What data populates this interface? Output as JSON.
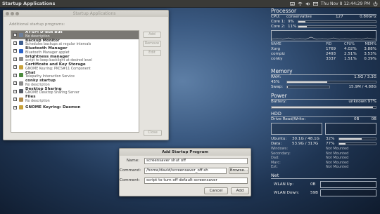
{
  "panel": {
    "title": "Startup Applications",
    "clock": "Thu Nov 8 12:44:29 PM",
    "icons": [
      "keyboard-icon",
      "wifi-icon",
      "volume-icon",
      "mail-icon",
      "power-icon"
    ]
  },
  "startup_window": {
    "section_label": "Additional startup programs:",
    "add_label": "Add",
    "remove_label": "Remove",
    "edit_label": "Edit",
    "close_label": "Close",
    "programs": [
      {
        "name": "AT-SPI D-Bus Bus",
        "description": "No description",
        "checked": true,
        "selected": true,
        "icon": "#6d7f9a"
      },
      {
        "name": "Backup Monitor",
        "description": "Schedules backups at regular intervals",
        "checked": true,
        "selected": false,
        "icon": "#3e5e8e"
      },
      {
        "name": "Bluetooth Manager",
        "description": "Bluetooth Manager applet",
        "checked": true,
        "selected": false,
        "icon": "#2a62c8"
      },
      {
        "name": "brightness manager",
        "description": "script to keep backlight at desired level",
        "checked": true,
        "selected": false,
        "icon": "#8a8a8a"
      },
      {
        "name": "Certificate and Key Storage",
        "description": "GNOME Keyring: PKCS#11 Component",
        "checked": true,
        "selected": false,
        "icon": "#c8a13a"
      },
      {
        "name": "Chat",
        "description": "Telepathy Interaction Service",
        "checked": true,
        "selected": false,
        "icon": "#4b8a3c"
      },
      {
        "name": "conky startup",
        "description": "No description",
        "checked": true,
        "selected": false,
        "icon": "#8a8a8a"
      },
      {
        "name": "Desktop Sharing",
        "description": "GNOME Desktop Sharing Server",
        "checked": true,
        "selected": false,
        "icon": "#555b66"
      },
      {
        "name": "Files",
        "description": "No description",
        "checked": true,
        "selected": false,
        "icon": "#b08a4a"
      },
      {
        "name": "GNOME Keyring: Daemon",
        "description": "",
        "checked": true,
        "selected": false,
        "icon": "#c8a13a"
      }
    ]
  },
  "add_dialog": {
    "title": "Add Startup Program",
    "name_label": "Name:",
    "name_value": "screensaver shut off",
    "command_label": "Command:",
    "command_value": "/home/david/screensaver_off.sh",
    "comment_label": "Comment:",
    "comment_value": "script to turn off default screensaver",
    "browse_label": "Browse...",
    "cancel_label": "Cancel",
    "add_label": "Add"
  },
  "conky": {
    "processor": {
      "title": "Processor",
      "cpu_label": "CPU:",
      "governor": "conservative",
      "temp": "127",
      "freq": "0.80GHz",
      "core1_label": "Core 1:",
      "core1_pct": "9%",
      "core1_value": 0.09,
      "core2_label": "Core 2:",
      "core2_pct": "11%",
      "core2_value": 0.11,
      "table_header": [
        "NAME",
        "PID",
        "CPU%",
        "MEM%"
      ],
      "procs": [
        {
          "name": "Xorg",
          "pid": "1769",
          "cpu": "4.02%",
          "mem": "3.88%"
        },
        {
          "name": "compiz",
          "pid": "2493",
          "cpu": "2.51%",
          "mem": "3.53%"
        },
        {
          "name": "conky",
          "pid": "3337",
          "cpu": "1.51%",
          "mem": "0.39%"
        }
      ]
    },
    "memory": {
      "title": "Memory",
      "ram_label": "RAM:",
      "ram_value": "1.5G / 3.3G",
      "ram_pct": "45%",
      "ram_fraction": 0.45,
      "swap_label": "Swap:",
      "swap_value": "15.9M / 4.88G",
      "swap_fraction": 0.01
    },
    "power": {
      "title": "Power",
      "battery_label": "Battery:",
      "battery_value": "unknown 97%",
      "battery_fraction": 0.97
    },
    "hdd": {
      "title": "HDD",
      "rw_label": "Drive Read/Write:",
      "read": "0B",
      "write": "0B",
      "fs": [
        {
          "name": "Ubuntu:",
          "used": "30.1G / 48.1G",
          "pct": "32%",
          "fraction": 0.62
        },
        {
          "name": "Data:",
          "used": "53.9G / 317G",
          "pct": "77%",
          "fraction": 0.17
        }
      ],
      "unmounted": [
        {
          "name": "Windows:",
          "status": "Not Mounted"
        },
        {
          "name": "Secondary:",
          "status": "Not Mounted"
        },
        {
          "name": "Dad:",
          "status": "Not Mounted"
        },
        {
          "name": "Marc:",
          "status": "Not Mounted"
        },
        {
          "name": "Ext:",
          "status": "Not Mounted"
        }
      ]
    },
    "net": {
      "title": "Net",
      "up_label": "WLAN Up:",
      "up_value": "0B",
      "down_label": "WLAN Down:",
      "down_value": "59B"
    }
  },
  "colors": {
    "panel_bg": "#3a3a37",
    "dialog_bg": "#e5e3de",
    "selection": "#7a7873",
    "conky_text": "#e8e8e8"
  }
}
